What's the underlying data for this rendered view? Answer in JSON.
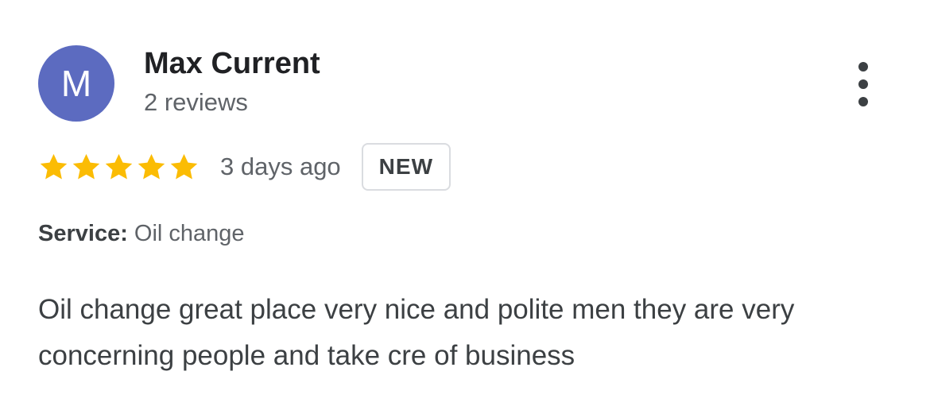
{
  "reviewer": {
    "initial": "M",
    "avatar_color": "#5c6bc0",
    "name": "Max Current",
    "review_count": "2 reviews"
  },
  "menu": {
    "icon": "more-vert-icon"
  },
  "rating": {
    "stars": 5,
    "max_stars": 5,
    "star_color": "#fbbc04",
    "date": "3 days ago",
    "badge": "NEW"
  },
  "service": {
    "label": "Service:",
    "value": "Oil change"
  },
  "review": {
    "text": "Oil change great place very nice and polite men they are very concerning people and take cre of business"
  }
}
